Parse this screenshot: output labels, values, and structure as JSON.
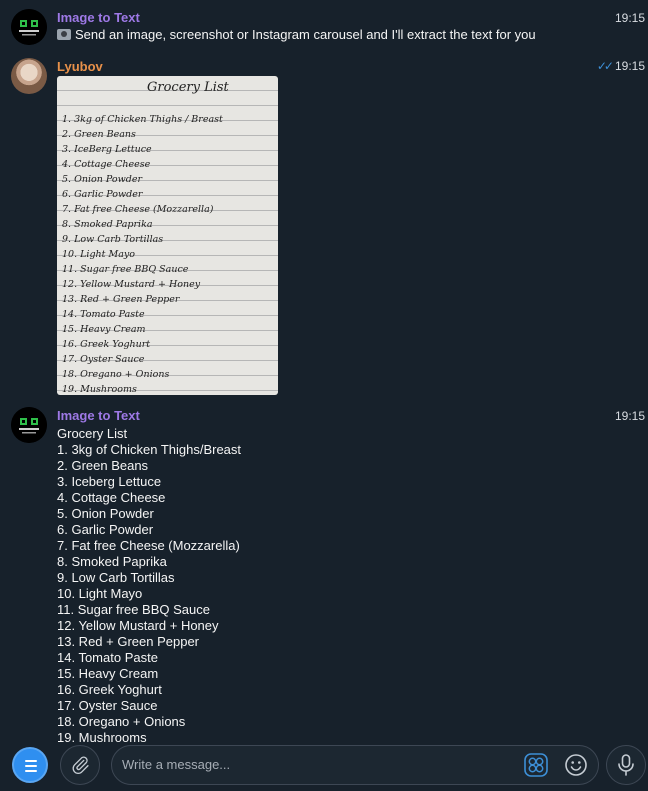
{
  "messages": [
    {
      "sender": "Image to Text",
      "time": "19:15",
      "text": "Send an image, screenshot or Instagram carousel and I'll extract the text for you",
      "avatar": "bot-logo-icon"
    },
    {
      "sender": "Lyubov",
      "time": "19:15",
      "read_checks": "✓✓",
      "avatar": "user-photo",
      "photo": {
        "title": "Grocery List",
        "lines": [
          "1. 3kg of Chicken Thighs / Breast",
          "2. Green Beans",
          "3. IceBerg Lettuce",
          "4. Cottage Cheese",
          "5. Onion Powder",
          "6. Garlic Powder",
          "7. Fat free Cheese (Mozzarella)",
          "8. Smoked Paprika",
          "9. Low Carb Tortillas",
          "10. Light Mayo",
          "11. Sugar free BBQ Sauce",
          "12. Yellow Mustard + Honey",
          "13. Red + Green Pepper",
          "14. Tomato Paste",
          "15. Heavy Cream",
          "16. Greek Yoghurt",
          "17. Oyster Sauce",
          "18. Oregano + Onions",
          "19. Mushrooms"
        ]
      }
    },
    {
      "sender": "Image to Text",
      "time": "19:15",
      "avatar": "bot-logo-icon",
      "ocr_title": "Grocery List",
      "ocr_lines": [
        "1. 3kg of Chicken Thighs/Breast",
        "2. Green Beans",
        "3. Iceberg Lettuce",
        "4. Cottage Cheese",
        "5. Onion Powder",
        "6. Garlic Powder",
        "7. Fat free Cheese (Mozzarella)",
        "8. Smoked Paprika",
        "9. Low Carb Tortillas",
        "10. Light Mayo",
        "11. Sugar free BBQ Sauce",
        "12. Yellow Mustard + Honey",
        "13. Red + Green Pepper",
        "14. Tomato Paste",
        "15. Heavy Cream",
        "16. Greek Yoghurt",
        "17. Oyster Sauce",
        "18. Oregano + Onions",
        "19. Mushrooms"
      ]
    }
  ],
  "composer": {
    "placeholder": "Write a message..."
  },
  "colors": {
    "background": "#17212b",
    "bot_name": "#9e79e6",
    "user_name": "#e8914a",
    "accent": "#2f8ff0"
  }
}
